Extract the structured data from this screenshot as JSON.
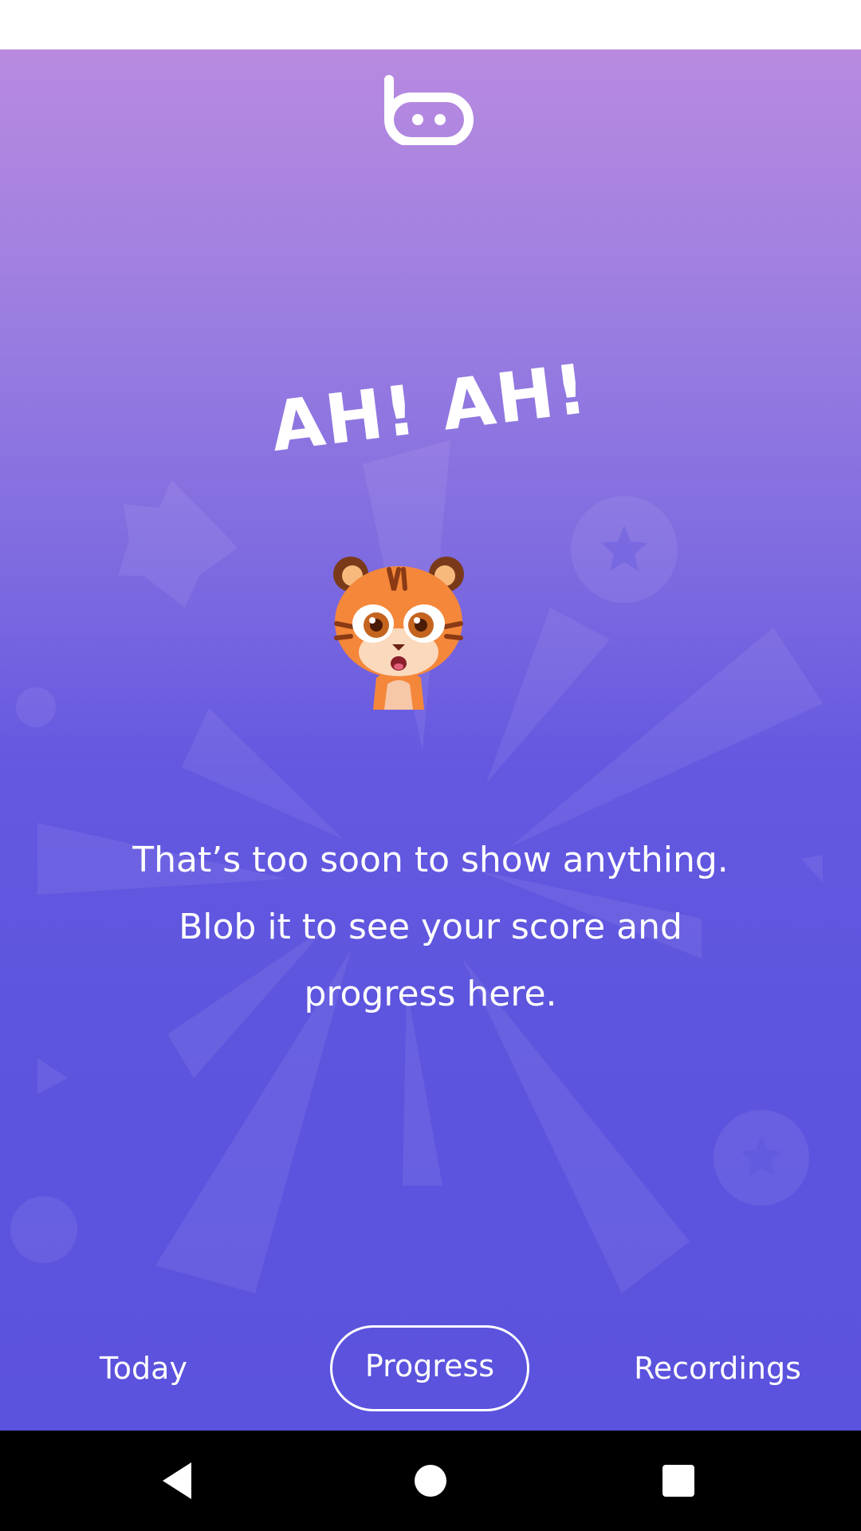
{
  "headline": "AH! AH!",
  "message": {
    "line1": "That’s too soon to show anything.",
    "line2": "Blob it to see your score and",
    "line3": "progress here."
  },
  "tabs": {
    "today": "Today",
    "progress": "Progress",
    "recordings": "Recordings",
    "selected": "Progress"
  },
  "icons": {
    "logo": "app-logo-icon",
    "mascot": "tiger-mascot-icon",
    "back": "back-icon",
    "home": "home-icon",
    "recents": "recents-icon"
  },
  "colors": {
    "gradient_top": "#b88ae0",
    "gradient_bottom": "#5b52dd",
    "text": "#ffffff",
    "nav_bar": "#000000"
  }
}
